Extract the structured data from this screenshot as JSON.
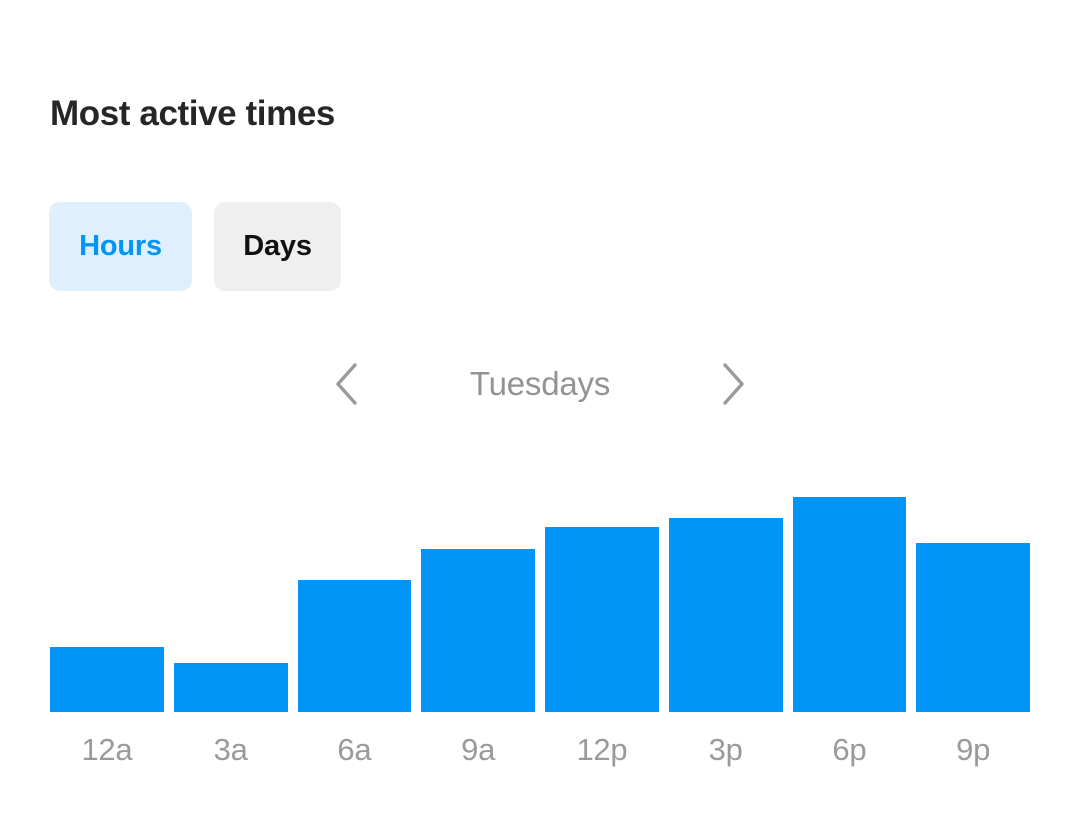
{
  "card": {
    "title": "Most active times"
  },
  "toggle": {
    "options": [
      {
        "label": "Hours",
        "state": "selected"
      },
      {
        "label": "Days",
        "state": "unselected"
      }
    ]
  },
  "navigator": {
    "prev_icon": "chevron-left-icon",
    "next_icon": "chevron-right-icon",
    "current_label": "Tuesdays"
  },
  "colors": {
    "bar": "#0095f6",
    "pill_selected_bg": "#dfeffd",
    "pill_selected_text": "#0095f6",
    "pill_unselected_bg": "#efefef",
    "pill_unselected_text": "#111111",
    "title_text": "#262626",
    "muted_text": "#939393",
    "background": "#ffffff"
  },
  "chart_data": {
    "type": "bar",
    "title": "Most active times",
    "subtitle": "Tuesdays",
    "xlabel": "",
    "ylabel": "",
    "categories": [
      "12a",
      "3a",
      "6a",
      "9a",
      "12p",
      "3p",
      "6p",
      "9p"
    ],
    "values": [
      65,
      49,
      132,
      163,
      185,
      194,
      215,
      169
    ],
    "ylim": [
      0,
      250
    ],
    "grid": false,
    "legend": false,
    "bar_color": "#0095f6",
    "max_category": "6p",
    "min_category": "3a"
  }
}
